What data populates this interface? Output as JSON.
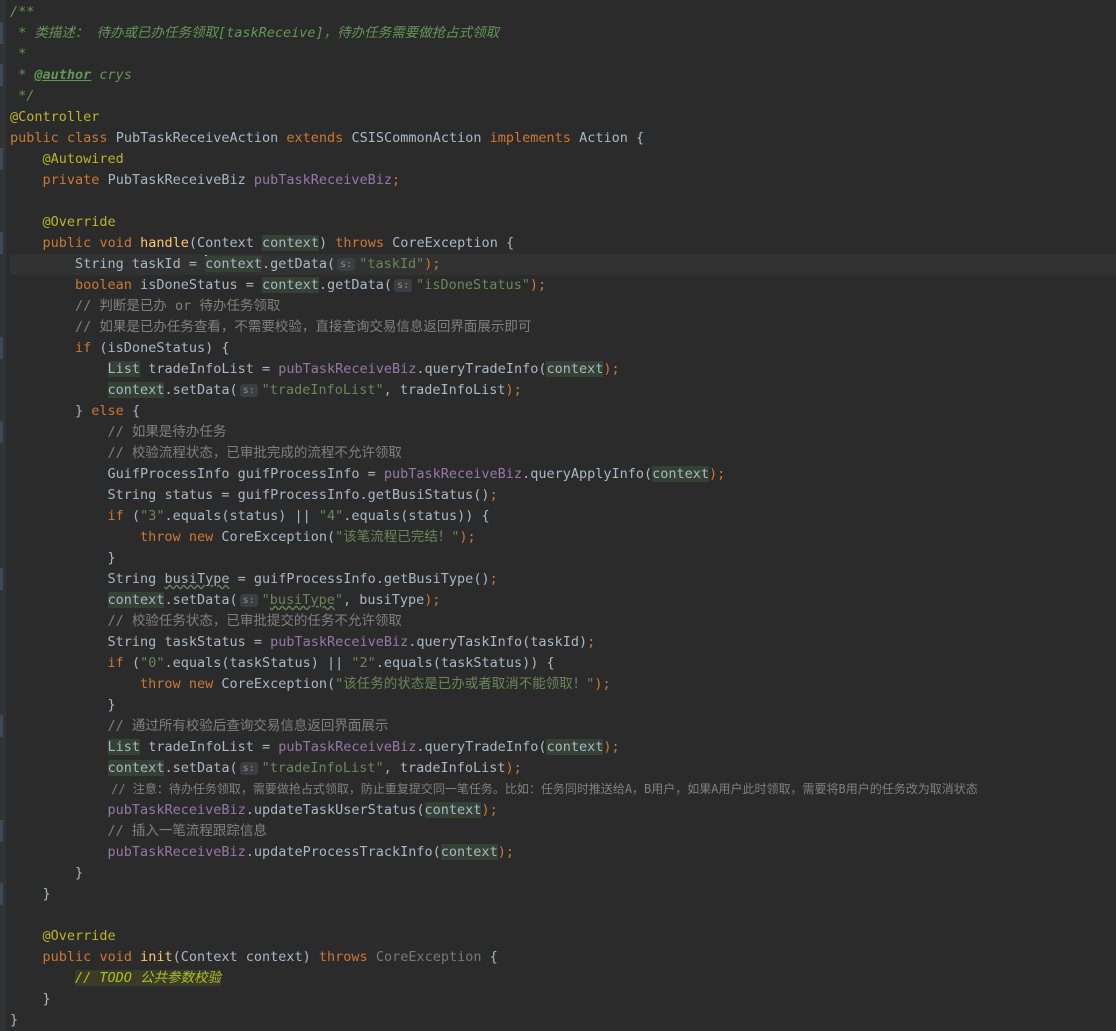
{
  "editor": {
    "language": "java",
    "class_name": "PubTaskReceiveAction",
    "param_hint": "s:"
  },
  "code": {
    "l1": "/**",
    "l2": " * 类描述： 待办或已办任务领取[taskReceive]，待办任务需要做抢占式领取",
    "l3": " *",
    "l4_prefix": " * ",
    "l4_tag": "@author",
    "l4_name": " crys",
    "l5": " */",
    "l6": "@Controller",
    "l7_public": "public",
    "l7_class": "class",
    "l7_name": "PubTaskReceiveAction",
    "l7_extends": "extends",
    "l7_parent": "CSISCommonAction",
    "l7_implements": "implements",
    "l7_iface": "Action",
    "l7_brace": "{",
    "l8": "@Autowired",
    "l9_private": "private",
    "l9_type": "PubTaskReceiveBiz",
    "l9_field": "pubTaskReceiveBiz",
    "l11": "@Override",
    "l12_public": "public",
    "l12_void": "void",
    "l12_name": "handle",
    "l12_param_type": "(Context",
    "l12_param": "context",
    "l12_close": ")",
    "l12_throws": "throws",
    "l12_exc": "CoreException {",
    "l13_decl": "String taskId = ",
    "l13_ctx": "context",
    "l13_call": ".getData(",
    "l13_str": "\"taskId\"",
    "l13_end": ");",
    "l14_boolean": "boolean",
    "l14_decl": " isDoneStatus = ",
    "l14_ctx": "context",
    "l14_call": ".getData(",
    "l14_str": "\"isDoneStatus\"",
    "l14_end": ");",
    "l15": "// 判断是已办 or 待办任务领取",
    "l16": "// 如果是已办任务查看，不需要校验，直接查询交易信息返回界面展示即可",
    "l17_if": "if",
    "l17_rest": " (isDoneStatus) {",
    "l18_list": "List",
    "l18_decl": " tradeInfoList = ",
    "l18_field": "pubTaskReceiveBiz",
    "l18_call": ".queryTradeInfo(",
    "l18_ctx": "context",
    "l18_end": ");",
    "l19_ctx": "context",
    "l19_call": ".setData(",
    "l19_str": "\"tradeInfoList\"",
    "l19_args": ", tradeInfoList",
    "l19_end": ");",
    "l20_open": "} ",
    "l20_else": "else",
    "l20_brace": " {",
    "l21": "// 如果是待办任务",
    "l22": "// 校验流程状态，已审批完成的流程不允许领取",
    "l23_decl": "GuifProcessInfo guifProcessInfo = ",
    "l23_field": "pubTaskReceiveBiz",
    "l23_call": ".queryApplyInfo(",
    "l23_ctx": "context",
    "l23_end": ");",
    "l24": "String status = guifProcessInfo.getBusiStatus()",
    "l24_end": ";",
    "l25_if": "if",
    "l25_open": " (",
    "l25_s1": "\"3\"",
    "l25_mid": ".equals(status) || ",
    "l25_s2": "\"4\"",
    "l25_end": ".equals(status)) {",
    "l26_throw": "throw",
    "l26_new": "new",
    "l26_exc": " CoreException(",
    "l26_str": "\"该笔流程已完结！\"",
    "l26_end": ");",
    "l27": "}",
    "l28_decl": "String ",
    "l28_var": "busiType",
    "l28_rest": " = guifProcessInfo.getBusiType()",
    "l28_end": ";",
    "l29_ctx": "context",
    "l29_call": ".setData(",
    "l29_q1": "\"",
    "l29_str": "busiType",
    "l29_q2": "\"",
    "l29_args": ", busiType",
    "l29_end": ");",
    "l30": "// 校验任务状态，已审批提交的任务不允许领取",
    "l31_decl": "String taskStatus = ",
    "l31_field": "pubTaskReceiveBiz",
    "l31_call": ".queryTaskInfo(taskId)",
    "l31_end": ";",
    "l32_if": "if",
    "l32_open": " (",
    "l32_s1": "\"0\"",
    "l32_mid": ".equals(taskStatus) || ",
    "l32_s2": "\"2\"",
    "l32_end": ".equals(taskStatus)) {",
    "l33_throw": "throw",
    "l33_new": "new",
    "l33_exc": " CoreException(",
    "l33_str": "\"该任务的状态是已办或者取消不能领取！\"",
    "l33_end": ");",
    "l34": "}",
    "l35": "// 通过所有校验后查询交易信息返回界面展示",
    "l36_list": "List",
    "l36_decl": " tradeInfoList = ",
    "l36_field": "pubTaskReceiveBiz",
    "l36_call": ".queryTradeInfo(",
    "l36_ctx": "context",
    "l36_end": ");",
    "l37_ctx": "context",
    "l37_call": ".setData(",
    "l37_str": "\"tradeInfoList\"",
    "l37_args": ", tradeInfoList",
    "l37_end": ");",
    "l38": "// 注意：待办任务领取，需要做抢占式领取，防止重复提交同一笔任务。比如：任务同时推送给A，B用户，如果A用户此时领取，需要将B用户的任务改为取消状态",
    "l39_field": "pubTaskReceiveBiz",
    "l39_call": ".updateTaskUserStatus(",
    "l39_ctx": "context",
    "l39_end": ");",
    "l40": "// 插入一笔流程跟踪信息",
    "l41_field": "pubTaskReceiveBiz",
    "l41_call": ".updateProcessTrackInfo(",
    "l41_ctx": "context",
    "l41_end": ");",
    "l42": "}",
    "l43": "}",
    "l45": "@Override",
    "l46_public": "public",
    "l46_void": "void",
    "l46_name": "init",
    "l46_params": "(Context context) ",
    "l46_throws": "throws",
    "l46_exc": "CoreException",
    "l46_brace": " {",
    "l47_todo": "// TODO 公共参数校验",
    "l48": "}",
    "l49": "}"
  }
}
